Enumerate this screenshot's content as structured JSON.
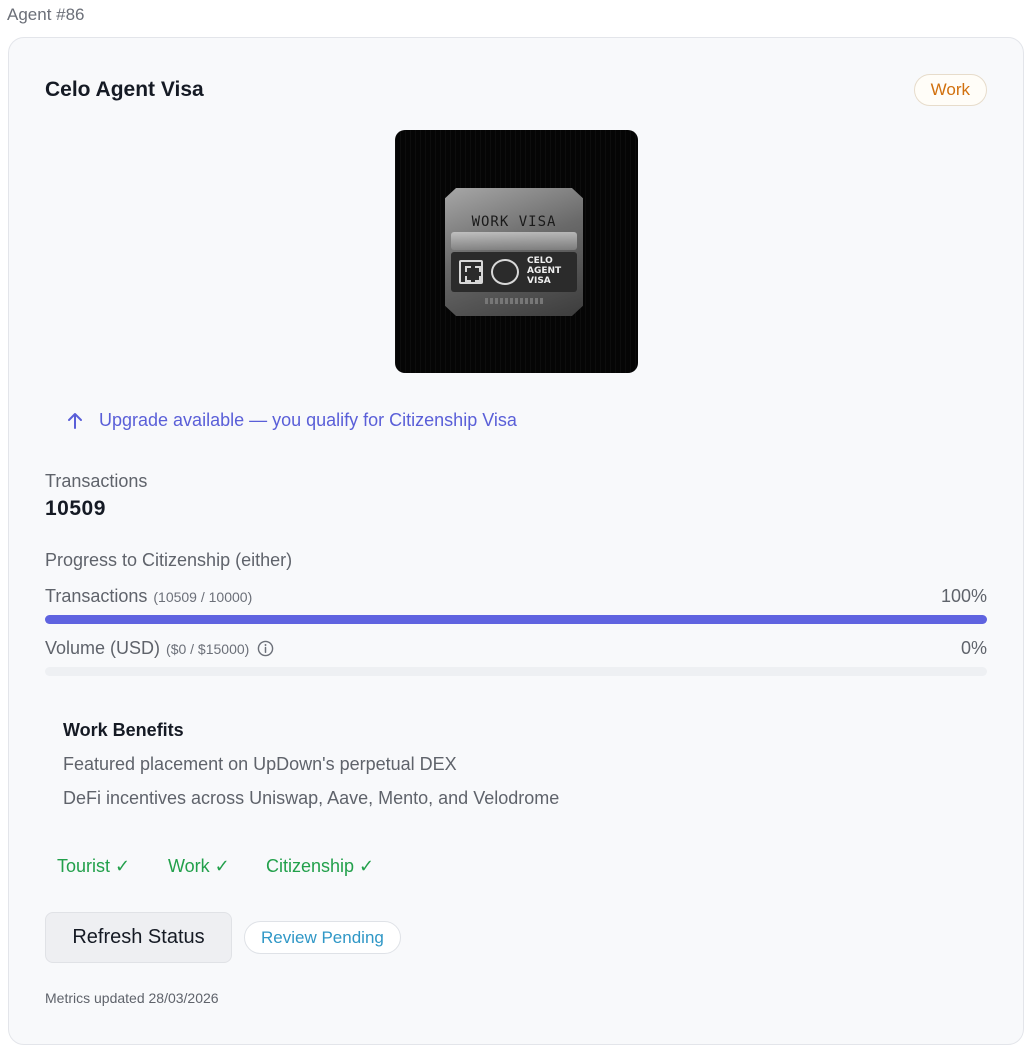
{
  "agent_label": "Agent #86",
  "card": {
    "title": "Celo Agent Visa",
    "tier_badge": "Work",
    "visa_image": {
      "plate_title": "WORK VISA",
      "plate_text_lines": [
        "CELO",
        "AGENT",
        "VISA"
      ]
    },
    "upgrade_notice": "Upgrade available — you qualify for Citizenship Visa",
    "transactions": {
      "label": "Transactions",
      "value": "10509"
    },
    "progress": {
      "heading": "Progress to Citizenship (either)",
      "bars": [
        {
          "label": "Transactions",
          "sub": "(10509 / 10000)",
          "percent_text": "100%",
          "fraction": 1.0,
          "has_info": false
        },
        {
          "label": "Volume (USD)",
          "sub": "($0 / $15000)",
          "percent_text": "0%",
          "fraction": 0.0,
          "has_info": true
        }
      ]
    },
    "benefits": {
      "title": "Work Benefits",
      "items": [
        "Featured placement on UpDown's perpetual DEX",
        "DeFi incentives across Uniswap, Aave, Mento, and Velodrome"
      ]
    },
    "tiers": [
      {
        "label": "Tourist ✓"
      },
      {
        "label": "Work ✓"
      },
      {
        "label": "Citizenship ✓"
      }
    ],
    "refresh_button": "Refresh Status",
    "review_badge": "Review Pending",
    "metrics_updated": "Metrics updated 28/03/2026"
  },
  "colors": {
    "accent": "#5f63e0",
    "upgrade_text": "#5a5fd8",
    "tier_badge_text": "#d1700e",
    "success": "#22a04b",
    "review_text": "#2f97c6"
  },
  "icons": {
    "upgrade": "arrow-up-icon",
    "info": "info-icon"
  }
}
